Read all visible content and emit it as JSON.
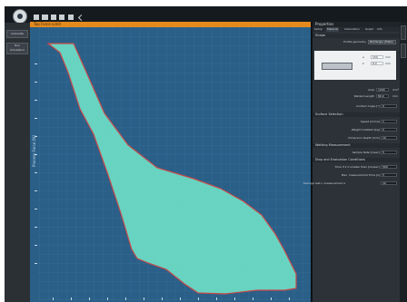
{
  "titlebar": {
    "icons": [
      "app-logo-icon",
      "open-icon",
      "save-icon",
      "save-as-icon",
      "print-icon",
      "export-icon",
      "undo-icon"
    ]
  },
  "left_panel": {
    "buttons": [
      "Calculate",
      "Run Simulation"
    ]
  },
  "plot_window": {
    "title": "Top Force Limit",
    "y_axis_label": "Process Force [N]",
    "colors": {
      "background": "#2a5f88",
      "fill": "#6fe0c8",
      "outline": "#c84a4a",
      "title_bar": "#e48a1d"
    }
  },
  "right_panel": {
    "header": "Properties",
    "tabs": [
      "Setup",
      "Material",
      "Calculation",
      "Graph",
      "Info"
    ],
    "shape_section": "Shape",
    "profile_geometry_label": "Profile geometry",
    "profile_geometry_value": "Rectangle (Plate)",
    "preview_dims": [
      {
        "label": "a",
        "value": "150",
        "unit": "mm"
      },
      {
        "label": "b",
        "value": "8.0",
        "unit": "mm"
      }
    ],
    "area_label": "Area",
    "area_value": "1200",
    "area_unit": "mm²",
    "weld_length_label": "Welded Length",
    "weld_length_value": "80.0",
    "weld_length_unit": "mm",
    "contact_angle_label": "Contact Angle [°]",
    "contact_angle_value": "0",
    "surface_section": "Surface Selection",
    "surface_rows": [
      {
        "label": "Speed [mm/s]",
        "value": "1"
      },
      {
        "label": "Weight Installed [kg]",
        "value": "0"
      },
      {
        "label": "Immersion Depth [mm]",
        "value": "10"
      }
    ],
    "wetting_section": "Wetting Measurement",
    "wetting_rows": [
      {
        "label": "Sample Rate [1/sec]",
        "value": "5"
      }
    ],
    "stop_section": "Stop and Evaluation Conditions",
    "stop_rows": [
      {
        "label": "Time if 2 σ smaller than [ms/sec]",
        "value": "500"
      },
      {
        "label": "Max. measurement Time [s]",
        "value": "5"
      },
      {
        "label": "Average last n measurement e",
        "value": "10"
      }
    ]
  }
}
